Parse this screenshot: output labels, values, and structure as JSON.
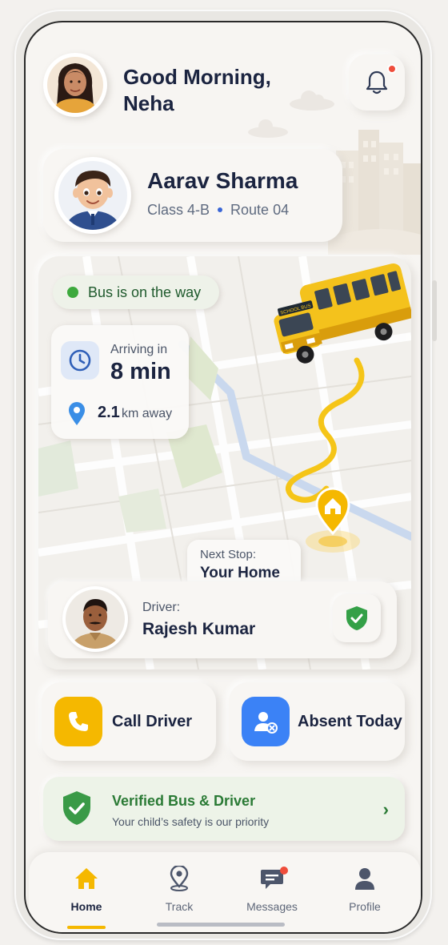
{
  "header": {
    "greeting_line1": "Good Morning,",
    "greeting_line2": "Neha",
    "notification_unread": true
  },
  "child": {
    "name": "Aarav Sharma",
    "class": "Class 4-B",
    "route": "Route 04"
  },
  "tracking": {
    "status": "Bus is on the way",
    "eta_label": "Arriving in",
    "eta_value": "8 min",
    "distance_value": "2.1",
    "distance_unit": "km away",
    "bus_sign": "SCHOOL BUS",
    "next_stop_label": "Next Stop:",
    "next_stop_value": "Your Home"
  },
  "driver": {
    "label": "Driver:",
    "name": "Rajesh Kumar",
    "verified_icon": "shield-check-icon"
  },
  "actions": {
    "call_label": "Call Driver",
    "absent_label": "Absent Today"
  },
  "verified_banner": {
    "title": "Verified Bus & Driver",
    "subtitle": "Your child’s safety is our priority"
  },
  "nav": {
    "items": [
      {
        "label": "Home",
        "icon": "home-icon",
        "active": true
      },
      {
        "label": "Track",
        "icon": "location-pin-icon",
        "active": false
      },
      {
        "label": "Messages",
        "icon": "message-icon",
        "active": false,
        "badge": true
      },
      {
        "label": "Profile",
        "icon": "person-icon",
        "active": false
      }
    ]
  },
  "colors": {
    "accent_yellow": "#f5b800",
    "status_green": "#3da93d",
    "text_dark": "#1b2440",
    "absent_blue": "#3b82f6",
    "alert_red": "#ef4d3b"
  }
}
